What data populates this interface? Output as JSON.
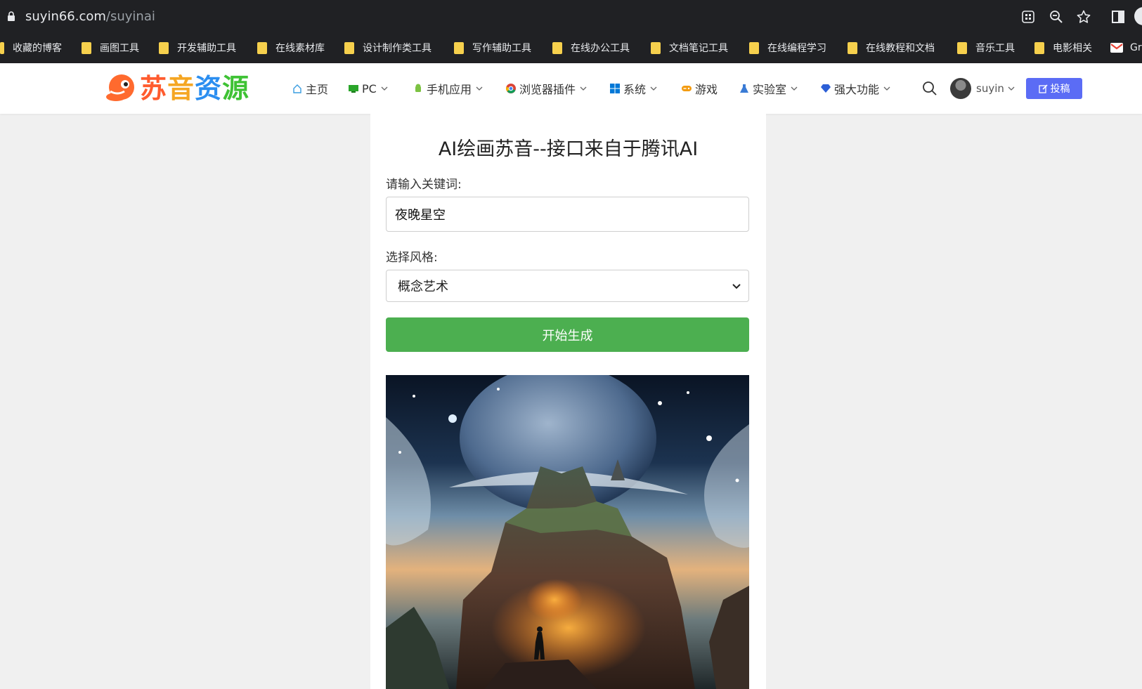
{
  "browser": {
    "url_host": "suyin66.com",
    "url_path": "/suyinai",
    "bookmarks": [
      {
        "label": "收藏的博客"
      },
      {
        "label": "画图工具"
      },
      {
        "label": "开发辅助工具"
      },
      {
        "label": "在线素材库"
      },
      {
        "label": "设计制作类工具"
      },
      {
        "label": "写作辅助工具"
      },
      {
        "label": "在线办公工具"
      },
      {
        "label": "文档笔记工具"
      },
      {
        "label": "在线编程学习"
      },
      {
        "label": "在线教程和文档"
      },
      {
        "label": "音乐工具"
      },
      {
        "label": "电影相关"
      },
      {
        "label": "Gr"
      }
    ]
  },
  "site": {
    "logo_text": [
      "苏",
      "音",
      "资",
      "源"
    ],
    "nav": [
      {
        "label": "主页",
        "icon": "home-icon",
        "has_dropdown": false
      },
      {
        "label": "PC",
        "icon": "monitor-icon",
        "has_dropdown": true
      },
      {
        "label": "手机应用",
        "icon": "android-icon",
        "has_dropdown": true
      },
      {
        "label": "浏览器插件",
        "icon": "chrome-icon",
        "has_dropdown": true
      },
      {
        "label": "系统",
        "icon": "windows-icon",
        "has_dropdown": true
      },
      {
        "label": "游戏",
        "icon": "gamepad-icon",
        "has_dropdown": false
      },
      {
        "label": "实验室",
        "icon": "flask-icon",
        "has_dropdown": true
      },
      {
        "label": "强大功能",
        "icon": "gem-icon",
        "has_dropdown": true
      }
    ],
    "username": "suyin",
    "submit_label": "投稿"
  },
  "form": {
    "title": "AI绘画苏音--接口来自于腾讯AI",
    "keyword_label": "请输入关键词:",
    "keyword_value": "夜晚星空",
    "style_label": "选择风格:",
    "style_value": "概念艺术",
    "generate_label": "开始生成"
  },
  "colors": {
    "generate_button": "#4caf50",
    "submit_button": "#5b6cf5",
    "browser_bar": "#202124",
    "folder": "#f6d04d"
  }
}
